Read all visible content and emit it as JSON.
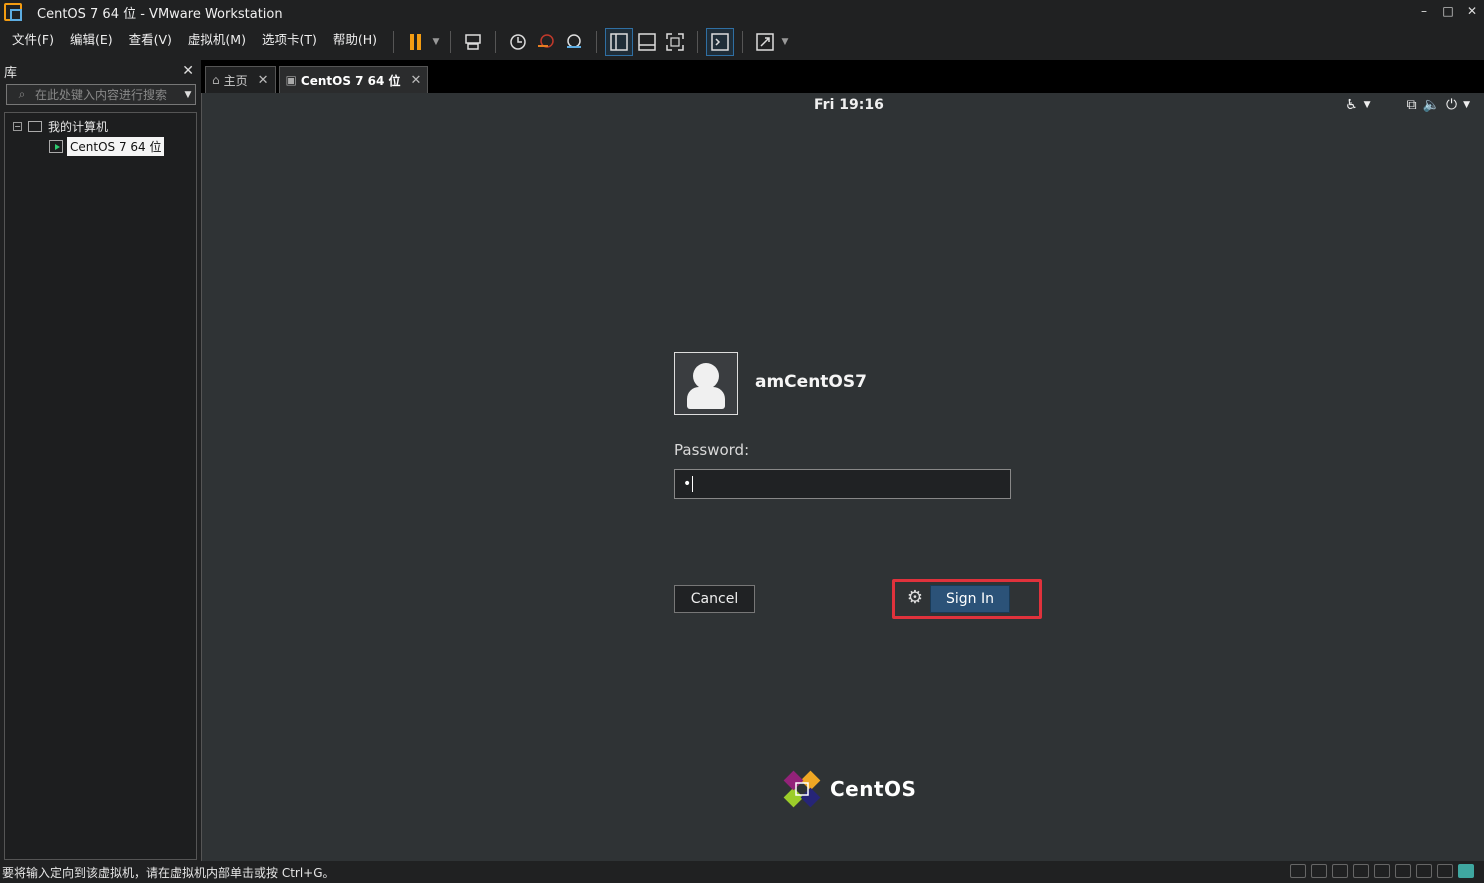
{
  "window": {
    "title": "CentOS 7 64 位 - VMware Workstation",
    "controls": {
      "minimize": "–",
      "maximize": "□",
      "close": "✕"
    }
  },
  "menu": {
    "items": [
      "文件(F)",
      "编辑(E)",
      "查看(V)",
      "虚拟机(M)",
      "选项卡(T)",
      "帮助(H)"
    ]
  },
  "toolbar": {
    "icons": [
      "pause-icon",
      "send-ctrl-alt-del-icon",
      "snapshot-icon",
      "revert-snapshot-icon",
      "snapshot-manager-icon",
      "show-library-icon",
      "show-thumbnail-icon",
      "full-screen-icon",
      "console-view-icon",
      "stretch-icon"
    ]
  },
  "library": {
    "title": "库",
    "close": "✕",
    "search_placeholder": "在此处键入内容进行搜索",
    "tree": {
      "root_label": "我的计算机",
      "root_expander": "−",
      "vm_label": "CentOS 7 64 位"
    }
  },
  "tabs": [
    {
      "label": "主页",
      "close": "✕"
    },
    {
      "label": "CentOS 7 64 位",
      "close": "✕"
    }
  ],
  "guest": {
    "clock": "Fri 19:16",
    "username": "amCentOS7",
    "password_label": "Password:",
    "password_value": "•",
    "cancel_label": "Cancel",
    "signin_label": "Sign In",
    "brand": "CentOS"
  },
  "status": {
    "message": "要将输入定向到该虚拟机，请在虚拟机内部单击或按 Ctrl+G。"
  },
  "colors": {
    "guest_bg": "#2f3335",
    "signin_bg": "#2b5278",
    "highlight": "#e0323c",
    "pause": "#f39c12"
  }
}
